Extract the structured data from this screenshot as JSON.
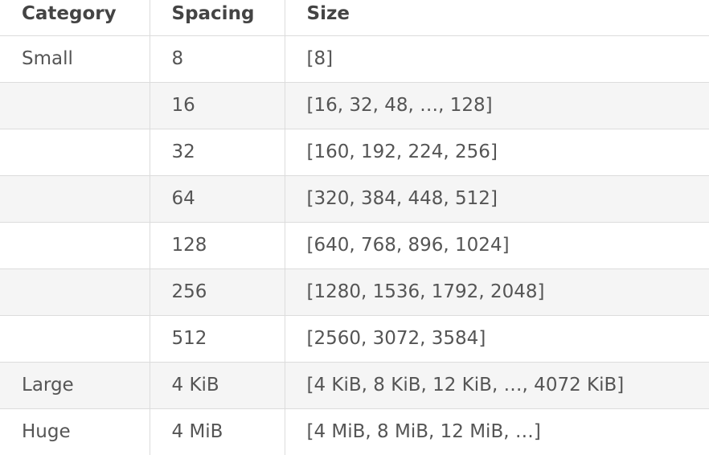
{
  "table": {
    "headers": [
      "Category",
      "Spacing",
      "Size"
    ],
    "rows": [
      {
        "category": "Small",
        "spacing": "8",
        "size": "[8]"
      },
      {
        "category": "",
        "spacing": "16",
        "size": "[16, 32, 48, …, 128]"
      },
      {
        "category": "",
        "spacing": "32",
        "size": "[160, 192, 224, 256]"
      },
      {
        "category": "",
        "spacing": "64",
        "size": "[320, 384, 448, 512]"
      },
      {
        "category": "",
        "spacing": "128",
        "size": "[640, 768, 896, 1024]"
      },
      {
        "category": "",
        "spacing": "256",
        "size": "[1280, 1536, 1792, 2048]"
      },
      {
        "category": "",
        "spacing": "512",
        "size": "[2560, 3072, 3584]"
      },
      {
        "category": "Large",
        "spacing": "4 KiB",
        "size": "[4 KiB, 8 KiB, 12 KiB, …, 4072 KiB]"
      },
      {
        "category": "Huge",
        "spacing": "4 MiB",
        "size": "[4 MiB, 8 MiB, 12 MiB, …]"
      }
    ]
  }
}
